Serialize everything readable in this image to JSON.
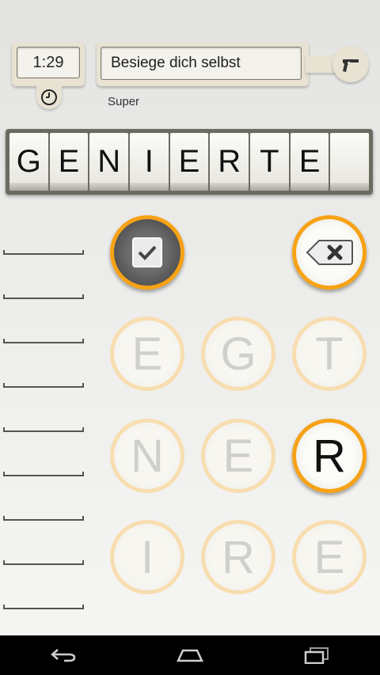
{
  "header": {
    "timer": "1:29",
    "title": "Besiege dich selbst",
    "rating": "Super",
    "icons": {
      "clock": "clock-icon",
      "gun": "revolver-icon"
    }
  },
  "word": {
    "tiles": [
      "G",
      "E",
      "N",
      "I",
      "E",
      "R",
      "T",
      "E",
      ""
    ]
  },
  "controls": {
    "check_icon": "check-icon",
    "delete_icon": "backspace-icon"
  },
  "letters": {
    "row1": [
      "E",
      "G",
      "T"
    ],
    "row2": [
      "N",
      "E",
      "R"
    ],
    "row3": [
      "I",
      "R",
      "E"
    ],
    "active": "R"
  },
  "navbar": {
    "icons": [
      "back-icon",
      "home-icon",
      "recent-apps-icon"
    ]
  },
  "colors": {
    "accent": "#f7a215",
    "faded_accent": "#f8ddb0",
    "panel": "#e7e2d2"
  }
}
